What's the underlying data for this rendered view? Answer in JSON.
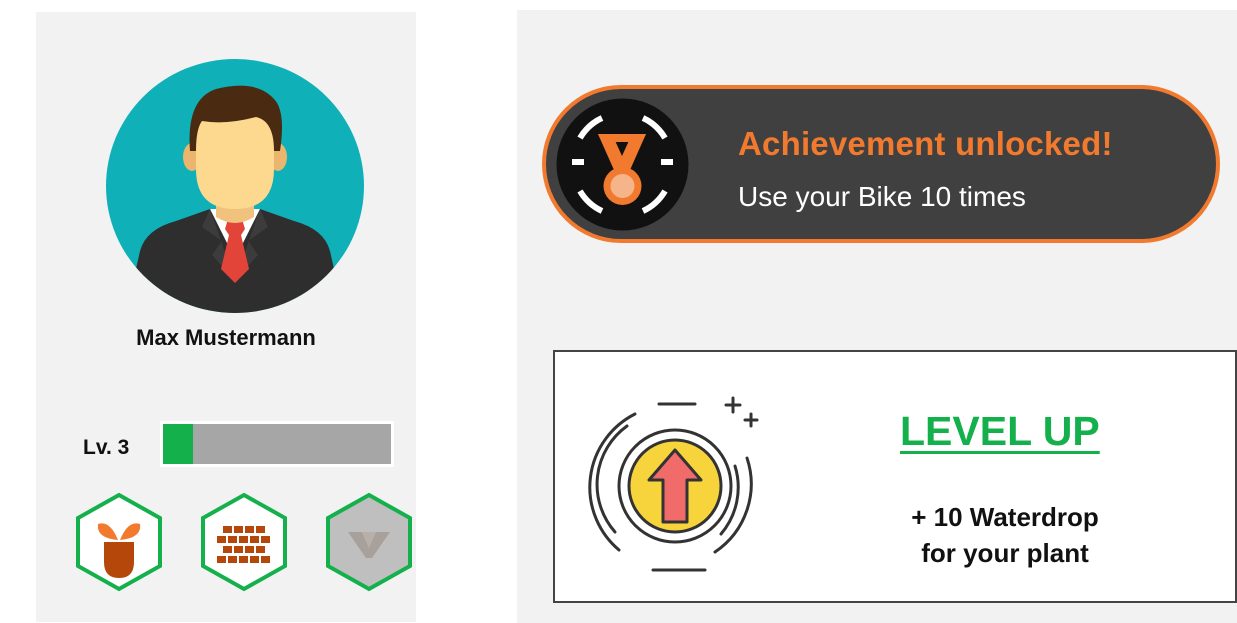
{
  "profile": {
    "name": "Max Mustermann",
    "level_label": "Lv. 3",
    "xp_progress": 0.13,
    "badges": [
      {
        "icon": "plant-sprout-icon",
        "unlocked": true
      },
      {
        "icon": "brick-wall-icon",
        "unlocked": true
      },
      {
        "icon": "locked-v-icon",
        "unlocked": false
      }
    ]
  },
  "achievement": {
    "title": "Achievement unlocked!",
    "description": "Use your Bike 10 times",
    "icon": "medal-icon"
  },
  "level_up": {
    "title": "LEVEL UP",
    "reward_line1": "+ 10 Waterdrop",
    "reward_line2": "for your plant",
    "icon": "level-up-arrow-icon"
  },
  "colors": {
    "accent_orange": "#f27a2e",
    "progress_green": "#14b04c",
    "avatar_teal": "#0fb0b8",
    "toast_dark": "#404040"
  }
}
